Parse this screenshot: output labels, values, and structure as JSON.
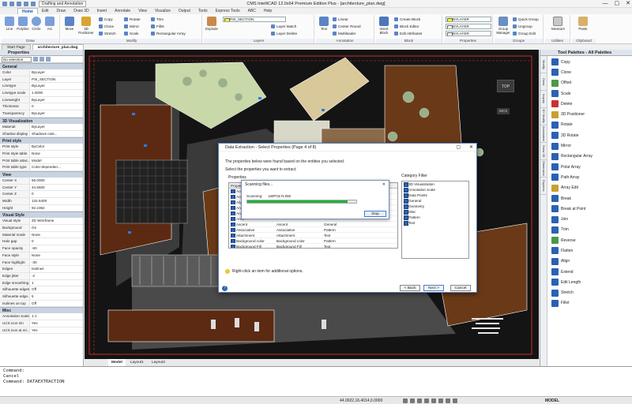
{
  "titlebar": {
    "workspace": "Drafting and Annotation",
    "title": "CMS IntelliCAD 12.0x64 Premium Edition Plus - [architecture_plan.dwg]",
    "min": "—",
    "max": "▢",
    "close": "✕"
  },
  "app_button": "≡",
  "ribbon_tabs": [
    "Home",
    "Edit",
    "Draw",
    "Draw 3D",
    "Insert",
    "Annotate",
    "View",
    "Visualize",
    "Output",
    "Tools",
    "Express Tools",
    "ABC",
    "Help"
  ],
  "ribbon": {
    "draw": {
      "label": "Draw",
      "line": "Line",
      "polyline": "Polyline",
      "circle": "Circle",
      "arc": "Arc"
    },
    "modify": {
      "label": "Modify",
      "move": "Move",
      "positioner": "3D Positioner",
      "copy": "Copy",
      "rotate": "Rotate",
      "trim": "Trim",
      "clone": "Clone",
      "mirror": "Mirror",
      "fillet": "Fillet",
      "stretch": "Stretch",
      "scale": "Scale",
      "rect_array": "Rectangular Array"
    },
    "layers": {
      "label": "Layers",
      "explode": "Explode",
      "layer_name": "PSI_SECTION",
      "layer_match": "Layer Match",
      "layer_delete": "Layer Delete"
    },
    "annotation": {
      "label": "Annotation",
      "text": "Text",
      "linear": "Linear",
      "center_round": "Center Round",
      "multileader": "Multileader"
    },
    "block": {
      "label": "Block",
      "insert": "Insert Block",
      "create": "Create Block",
      "editor": "Block Editor",
      "attributes": "Edit Attributes"
    },
    "properties": {
      "label": "Properties",
      "bylayer1": "BYLAYER",
      "bylayer2": "BYLAYER",
      "bylayer3": "BYLAYER",
      "color": "#ffff00"
    },
    "groups": {
      "label": "Groups",
      "manager": "Group Manager",
      "quick": "Quick Group",
      "ungroup": "Ungroup",
      "edit": "Group Edit"
    },
    "utilities": {
      "label": "Utilities",
      "measure": "Measure"
    },
    "clipboard": {
      "label": "Clipboard",
      "paste": "Paste"
    }
  },
  "file_tabs": [
    "Start Page",
    "architecture_plan.dwg"
  ],
  "properties_panel": {
    "title": "Properties",
    "selection": "No selection",
    "categories": [
      {
        "name": "General",
        "rows": [
          [
            "Color",
            "ByLayer"
          ],
          [
            "Layer",
            "PSI_SECTION"
          ],
          [
            "Linetype",
            "ByLayer"
          ],
          [
            "Linetype scale",
            "1.0000"
          ],
          [
            "Lineweight",
            "ByLayer"
          ],
          [
            "Thickness",
            "0"
          ],
          [
            "Transparency",
            "ByLayer"
          ]
        ]
      },
      {
        "name": "3D Visualization",
        "rows": [
          [
            "Material",
            "ByLayer"
          ],
          [
            "Shadow display",
            "Shadows cast..."
          ]
        ]
      },
      {
        "name": "Print style",
        "rows": [
          [
            "Print style",
            "ByColor"
          ],
          [
            "Print style table",
            "None"
          ],
          [
            "Print table attac...",
            "Model"
          ],
          [
            "Print table type",
            "Color-dependen..."
          ]
        ]
      },
      {
        "name": "View",
        "rows": [
          [
            "Center X",
            "66.0000"
          ],
          [
            "Center Y",
            "44.5500"
          ],
          [
            "Center Z",
            "0"
          ],
          [
            "Width",
            "134.6400"
          ],
          [
            "Height",
            "92.2362"
          ]
        ]
      },
      {
        "name": "Visual Style",
        "rows": [
          [
            "Visual style",
            "2D Wireframe"
          ],
          [
            "Background",
            "On"
          ],
          [
            "Material mode",
            "None"
          ],
          [
            "Halo gap",
            "0"
          ],
          [
            "Face opacity",
            "-60"
          ],
          [
            "Face style",
            "None"
          ],
          [
            "Face highlight",
            "-30"
          ],
          [
            "Edges",
            "Isolines"
          ],
          [
            "Edge jitter",
            "-2"
          ],
          [
            "Edge smoothing",
            "1"
          ],
          [
            "Silhouette edges",
            "Off"
          ],
          [
            "Silhouette edge...",
            "5"
          ],
          [
            "Isolines on top",
            "Off"
          ]
        ]
      },
      {
        "name": "Misc",
        "rows": [
          [
            "Annotation scale",
            "1:1"
          ],
          [
            "UCS icon On",
            "Yes"
          ],
          [
            "UCS icon at ori...",
            "Yes"
          ]
        ]
      }
    ]
  },
  "drawing": {
    "viewcube": "TOP",
    "wcs": "WCS"
  },
  "drawing_tabs": [
    "Model",
    "Layout1",
    "Layout2"
  ],
  "tool_palette": {
    "title": "Tool Palettes - All Palettes",
    "side_tabs": [
      "Modify",
      "Draw",
      "Inquiry",
      "3D Modify",
      "Annotation",
      "Draw 3D",
      "Dimension",
      "Express"
    ],
    "tools": [
      {
        "label": "Copy",
        "color": "#2a62b3"
      },
      {
        "label": "Clone",
        "color": "#2a62b3"
      },
      {
        "label": "Offset",
        "color": "#4a9a4a"
      },
      {
        "label": "Scale",
        "color": "#2a62b3"
      },
      {
        "label": "Delete",
        "color": "#c83232"
      },
      {
        "label": "3D Positioner",
        "color": "#c8a032"
      },
      {
        "label": "Rotate",
        "color": "#2a62b3"
      },
      {
        "label": "3D Rotate",
        "color": "#2a62b3"
      },
      {
        "label": "Mirror",
        "color": "#2a62b3"
      },
      {
        "label": "Rectangular Array",
        "color": "#2a62b3"
      },
      {
        "label": "Polar Array",
        "color": "#2a62b3"
      },
      {
        "label": "Path Array",
        "color": "#2a62b3"
      },
      {
        "label": "Array Edit",
        "color": "#c8a032"
      },
      {
        "label": "Break",
        "color": "#2a62b3"
      },
      {
        "label": "Break at Point",
        "color": "#2a62b3"
      },
      {
        "label": "Join",
        "color": "#2a62b3"
      },
      {
        "label": "Trim",
        "color": "#2a62b3"
      },
      {
        "label": "Reverse",
        "color": "#4a9a4a"
      },
      {
        "label": "Flatten",
        "color": "#2a62b3"
      },
      {
        "label": "Align",
        "color": "#2a62b3"
      },
      {
        "label": "Extend",
        "color": "#2a62b3"
      },
      {
        "label": "Edit Length",
        "color": "#2a62b3"
      },
      {
        "label": "Stretch",
        "color": "#2a62b3"
      },
      {
        "label": "Fillet",
        "color": "#2a62b3"
      }
    ]
  },
  "command_line": [
    "Command:",
    "Cancel",
    "Command: DATAEXTRACTION"
  ],
  "status": {
    "coords": "44.0022,16.4014,0.0000",
    "model": "MODEL"
  },
  "dialog": {
    "title": "Data Extraction - Select Properties (Page 4 of 8)",
    "line1": "The properties below were found based on the entities you selected.",
    "line2": "Select the properties you want to extract.",
    "properties_label": "Properties",
    "columns": [
      "Property",
      "Display Name",
      "Category"
    ],
    "rows": [
      [
        "Actu...",
        "",
        ""
      ],
      [
        "Actu...",
        "",
        ""
      ],
      [
        "Align...",
        "",
        ""
      ],
      [
        "Angle",
        "",
        ""
      ],
      [
        "Ann...",
        "",
        ""
      ],
      [
        "Area",
        "",
        ""
      ],
      [
        "Ascent",
        "Ascent",
        "General"
      ],
      [
        "Associative",
        "Associative",
        "Pattern"
      ],
      [
        "Attachment",
        "Attachment",
        "Text"
      ],
      [
        "Background color",
        "Background color",
        "Pattern"
      ],
      [
        "Background Fill",
        "Background Fill",
        "Text"
      ],
      [
        "Block Id",
        "Block Id",
        "General"
      ],
      [
        "Cast Shadows",
        "Cast Shadows",
        "General"
      ]
    ],
    "category_filter_label": "Category Filter",
    "categories": [
      "3D Visualization",
      "Annotation scale",
      "Data Points",
      "General",
      "Geometry",
      "Misc",
      "Pattern",
      "Text"
    ],
    "hint": "Right-click an item for additional options.",
    "help": "?",
    "back": "< Back",
    "next": "Next >",
    "cancel": "Cancel"
  },
  "progress": {
    "title": "Scanning files...",
    "scanning_label": "Scanning:",
    "scanning_value": "LWPOLYLINE",
    "percent": 0.92,
    "stop": "Stop",
    "close": "✕"
  }
}
